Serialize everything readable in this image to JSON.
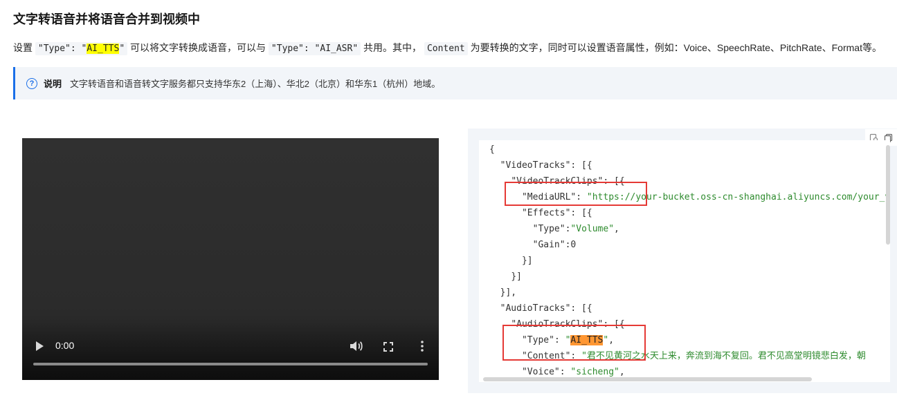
{
  "title": "文字转语音并将语音合并到视频中",
  "intro": {
    "p1": "设置",
    "c1": "\"Type\": \"",
    "c1_hl": "AI_TTS",
    "c1_end": "\"",
    "p2": "可以将文字转换成语音，可以与",
    "c2": "\"Type\": \"AI_ASR\"",
    "p3": "共用。其中，",
    "c3": "Content",
    "p4": "为要转换的文字，同时可以设置语音属性，例如：Voice、SpeechRate、PitchRate、Format等。"
  },
  "note": {
    "icon": "question-circle-icon",
    "label": "说明",
    "text": "文字转语音和语音转文字服务都只支持华东2（上海）、华北2（北京）和华东1（杭州）地域。"
  },
  "video": {
    "time": "0:00",
    "progress": 0
  },
  "code": {
    "line1": "{",
    "line2_key": "\"VideoTracks\"",
    "line2_rest": ": [{",
    "line3_key": "\"VideoTrackClips\"",
    "line3_rest": ": [{",
    "line4_key": "\"MediaURL\"",
    "line4_sep": ": ",
    "line4_val": "\"https://your-bucket.oss-cn-shanghai.aliyuncs.com/your_vi",
    "line5_key": "\"Effects\"",
    "line5_rest": ": [{",
    "line6_key": "\"Type\"",
    "line6_sep": ":",
    "line6_val": "\"Volume\"",
    "line6_end": ",",
    "line7_key": "\"Gain\"",
    "line7_rest": ":0",
    "line8": "}]",
    "line9": "}]",
    "line10": "}],",
    "line11_key": "\"AudioTracks\"",
    "line11_rest": ": [{",
    "line12_key": "\"AudioTrackClips\"",
    "line12_rest": ": [{",
    "line13_key": "\"Type\"",
    "line13_sep": ": ",
    "line13_q1": "\"",
    "line13_hl": "AI_TTS",
    "line13_q2": "\"",
    "line13_end": ",",
    "line14_key": "\"Content\"",
    "line14_sep": ": ",
    "line14_val": "\"君不见黄河之水天上来，奔流到海不复回。君不见高堂明镜悲白发，朝",
    "line15_key": "\"Voice\"",
    "line15_sep": ": ",
    "line15_val": "\"sicheng\"",
    "line15_end": ","
  },
  "toolbar": {
    "icon1": "run-icon",
    "icon2": "copy-icon"
  }
}
